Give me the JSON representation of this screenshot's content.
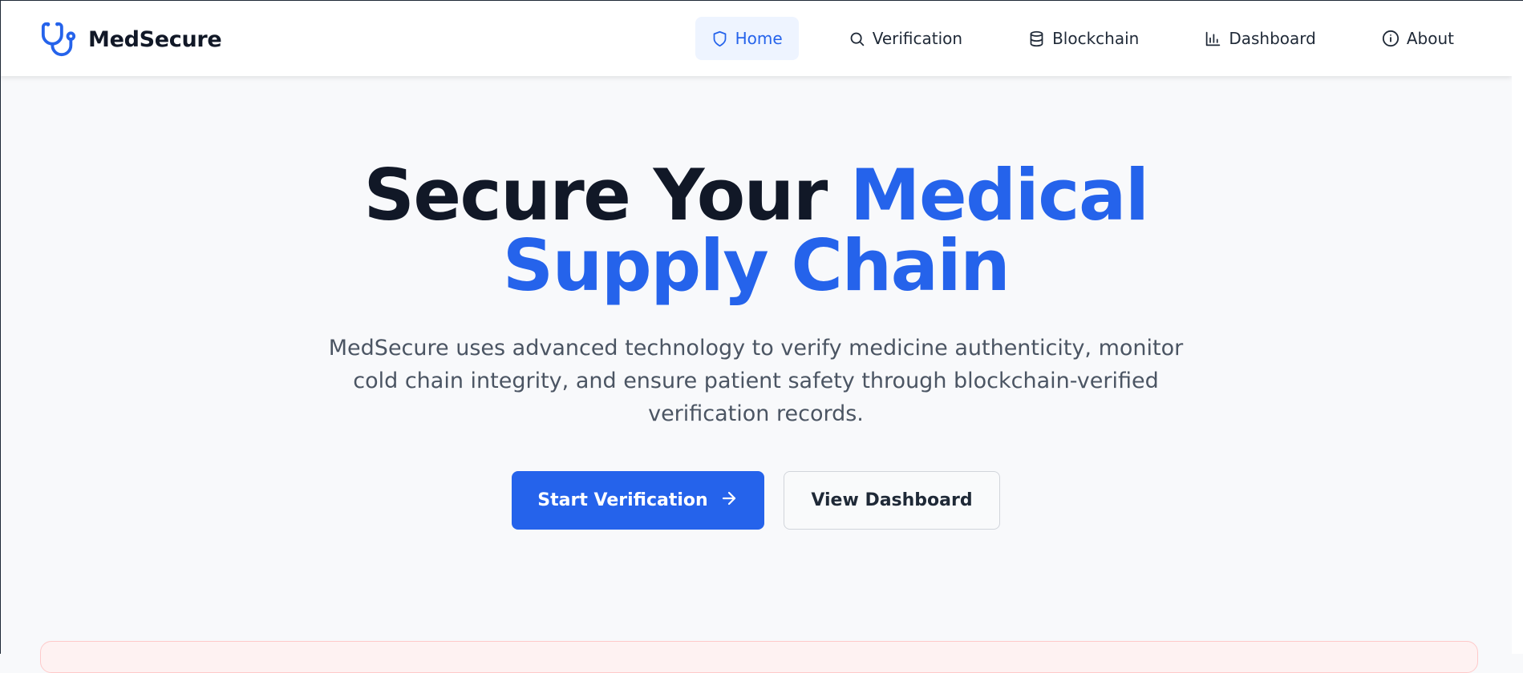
{
  "brand": {
    "name": "MedSecure",
    "icon": "stethoscope-icon"
  },
  "nav": {
    "items": [
      {
        "label": "Home",
        "icon": "shield-icon",
        "active": true
      },
      {
        "label": "Verification",
        "icon": "search-icon",
        "active": false
      },
      {
        "label": "Blockchain",
        "icon": "database-icon",
        "active": false
      },
      {
        "label": "Dashboard",
        "icon": "bar-chart-icon",
        "active": false
      },
      {
        "label": "About",
        "icon": "info-icon",
        "active": false
      }
    ]
  },
  "hero": {
    "title_part1": "Secure Your",
    "title_accent": "Medical Supply Chain",
    "subtitle": "MedSecure uses advanced technology to verify medicine authenticity, monitor cold chain integrity, and ensure patient safety through blockchain-verified verification records.",
    "primary_cta": "Start Verification",
    "secondary_cta": "View Dashboard"
  },
  "colors": {
    "accent": "#2563eb",
    "text_dark": "#111827",
    "text_muted": "#4b5563",
    "background": "#f8f9fb",
    "alert_bg": "#fef2f2",
    "alert_border": "#fecaca"
  }
}
